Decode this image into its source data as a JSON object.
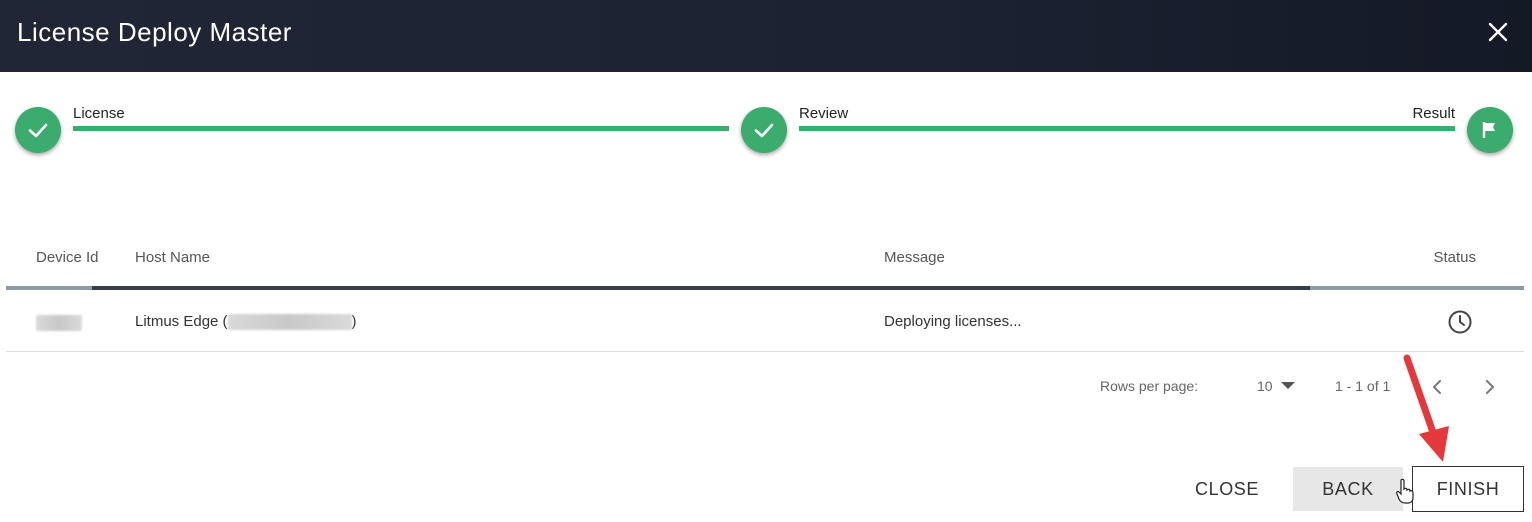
{
  "window": {
    "title": "License Deploy Master",
    "close_icon": "close-x-icon"
  },
  "stepper": {
    "steps": [
      {
        "label": "License",
        "state": "completed",
        "icon": "check-icon"
      },
      {
        "label": "Review",
        "state": "completed",
        "icon": "check-icon"
      },
      {
        "label": "Result",
        "state": "current",
        "icon": "flag-icon"
      }
    ],
    "accent_color": "#3cab6e"
  },
  "table": {
    "columns": [
      "Device Id",
      "Host Name",
      "Message",
      "Status"
    ],
    "rows": [
      {
        "device_id": "",
        "host_name_prefix": "Litmus Edge (",
        "host_name_suffix": ")",
        "message": "Deploying licenses...",
        "status_icon": "clock-icon"
      }
    ]
  },
  "pagination": {
    "rows_per_page_label": "Rows per page:",
    "rows_per_page_value": "10",
    "range": "1 - 1 of 1"
  },
  "actions": {
    "close_label": "CLOSE",
    "back_label": "BACK",
    "finish_label": "FINISH"
  }
}
